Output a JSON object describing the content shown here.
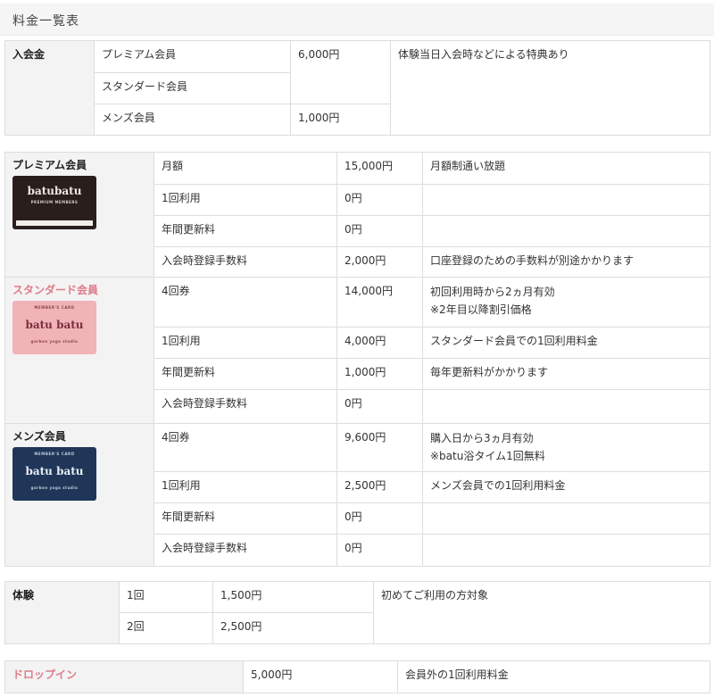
{
  "page_title": "料金一覧表",
  "entry_fee": {
    "label": "入会金",
    "rows": [
      {
        "type": "プレミアム会員",
        "price": "6,000円"
      },
      {
        "type": "スタンダード会員"
      },
      {
        "type": "メンズ会員",
        "price": "1,000円"
      }
    ],
    "note": "体験当日入会時などによる特典あり"
  },
  "memberships": [
    {
      "name": "プレミアム会員",
      "card": {
        "logo": "batubatu",
        "sub": "PREMIUM MEMBERS",
        "color": "#2a1e1c"
      },
      "rows": [
        {
          "item": "月額",
          "price": "15,000円",
          "note": "月額制通い放題"
        },
        {
          "item": "1回利用",
          "price": "0円",
          "note": ""
        },
        {
          "item": "年間更新料",
          "price": "0円",
          "note": ""
        },
        {
          "item": "入会時登録手数料",
          "price": "2,000円",
          "note": "口座登録のための手数料が別途かかります"
        }
      ]
    },
    {
      "name": "スタンダード会員",
      "card": {
        "logo": "batu batu",
        "topmark": "MEMBER'S CARD",
        "sub": "garbon yoga studio",
        "color": "#f0b3b6"
      },
      "rows": [
        {
          "item": "4回券",
          "price": "14,000円",
          "note": "初回利用時から2ヵ月有効\n※2年目以降割引価格"
        },
        {
          "item": "1回利用",
          "price": "4,000円",
          "note": "スタンダード会員での1回利用料金"
        },
        {
          "item": "年間更新料",
          "price": "1,000円",
          "note": "毎年更新料がかかります"
        },
        {
          "item": "入会時登録手数料",
          "price": "0円",
          "note": ""
        }
      ]
    },
    {
      "name": "メンズ会員",
      "card": {
        "logo": "batu batu",
        "topmark": "MEMBER'S CARD",
        "sub": "garbon yoga studio",
        "color": "#1f3658"
      },
      "rows": [
        {
          "item": "4回券",
          "price": "9,600円",
          "note": "購入日から3ヵ月有効\n※batu浴タイム1回無料"
        },
        {
          "item": "1回利用",
          "price": "2,500円",
          "note": "メンズ会員での1回利用料金"
        },
        {
          "item": "年間更新料",
          "price": "0円",
          "note": ""
        },
        {
          "item": "入会時登録手数料",
          "price": "0円",
          "note": ""
        }
      ]
    }
  ],
  "trial": {
    "label": "体験",
    "rows": [
      {
        "count": "1回",
        "price": "1,500円"
      },
      {
        "count": "2回",
        "price": "2,500円"
      }
    ],
    "note": "初めてご利用の方対象"
  },
  "dropin": {
    "label": "ドロップイン",
    "price": "5,000円",
    "note": "会員外の1回利用料金"
  }
}
